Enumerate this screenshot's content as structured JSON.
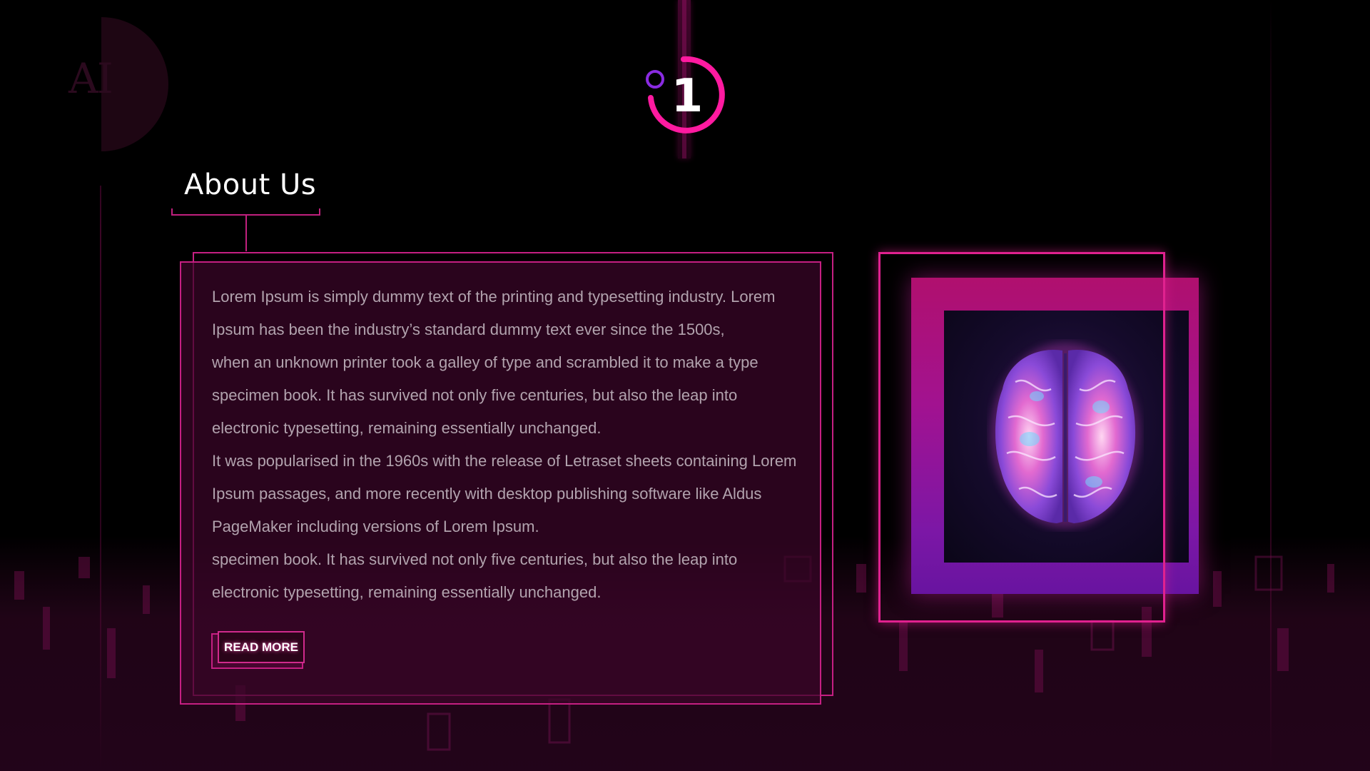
{
  "page": {
    "background_color": "#000000",
    "accent_color": "#e0218f",
    "accent_secondary_color": "#7c17a6"
  },
  "logo": {
    "text": "AI"
  },
  "step_indicator": {
    "number": "1",
    "ring_color": "#ff1aa0",
    "dot_color": "#8a2be2"
  },
  "about": {
    "title": "About Us",
    "paragraphs": [
      "Lorem Ipsum is simply dummy text of the printing and typesetting industry. Lorem",
      "Ipsum has been the industry’s standard dummy text ever since the 1500s,",
      "when an unknown printer took a galley of type and scrambled it to make a type",
      "specimen book. It has survived not only five centuries, but also the leap into",
      "electronic typesetting, remaining essentially unchanged.",
      "It was popularised in the 1960s with the release of Letraset sheets containing Lorem",
      "Ipsum passages, and more recently with desktop publishing software like Aldus",
      "PageMaker including versions of Lorem Ipsum.",
      "specimen book. It has survived not only five centuries, but also the leap into",
      "electronic typesetting, remaining essentially unchanged."
    ],
    "read_more_label": "READ MORE"
  },
  "image_card": {
    "subject_icon": "crystal-brain-image"
  }
}
